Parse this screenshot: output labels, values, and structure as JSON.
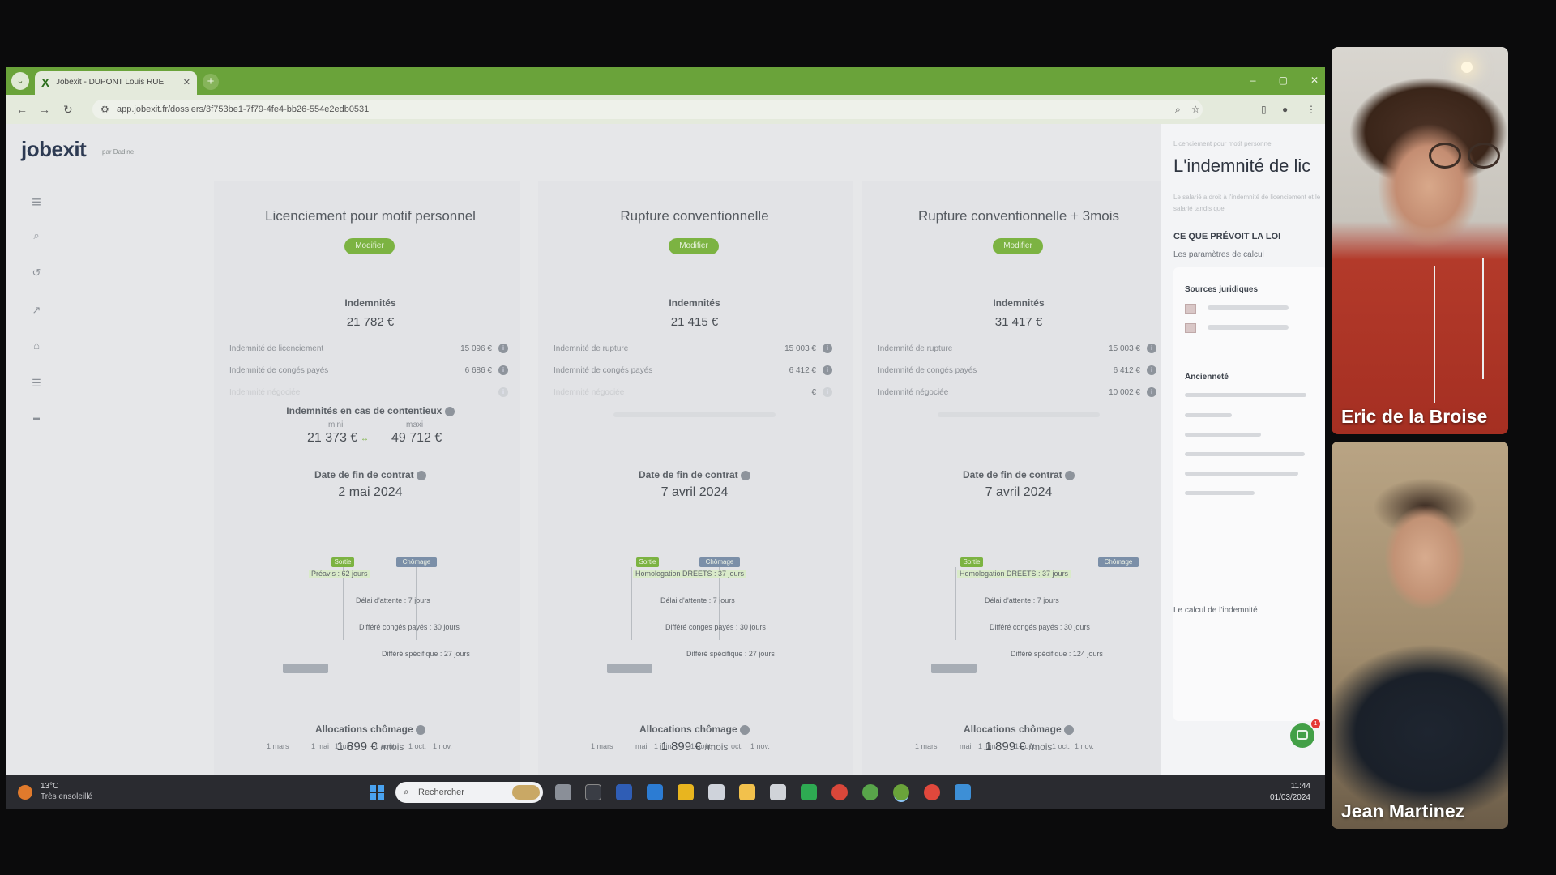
{
  "browser": {
    "tab_title": "Jobexit - DUPONT Louis RUE",
    "url": "app.jobexit.fr/dossiers/3f753be1-7f79-4fe4-bb26-554e2edb0531",
    "win_min": "–",
    "win_max": "▢",
    "win_close": "✕"
  },
  "app": {
    "logo": "jobexit",
    "logo_sub": "par Dadine",
    "columns": [
      {
        "title": "Licenciement pour motif personnel",
        "modifier": "Modifier",
        "indemnites_label": "Indemnités",
        "indemnites_total": "21 782 €",
        "lines": [
          {
            "label": "Indemnité de licenciement",
            "amount": "15 096 €"
          },
          {
            "label": "Indemnité de congés payés",
            "amount": "6 686 €"
          },
          {
            "label": "Indemnité négociée",
            "amount": ""
          }
        ],
        "contentieux_label": "Indemnités en cas de contentieux",
        "min_label": "mini",
        "max_label": "maxi",
        "min_value": "21 373 €",
        "max_value": "49 712 €",
        "date_label": "Date de fin de contrat",
        "date_value": "2 mai 2024",
        "timeline": [
          "Préavis : 62 jours",
          "Délai d'attente : 7 jours",
          "Différé congés payés : 30 jours",
          "Différé spécifique : 27 jours"
        ],
        "chips": [
          "Sortie",
          "Chômage"
        ],
        "axis": [
          "1 mars",
          "1 mai",
          "1 juin",
          "1 août",
          "1 oct.",
          "1 nov."
        ],
        "alloc_label": "Allocations chômage",
        "alloc_value": "1 899 €",
        "alloc_unit": "/mois"
      },
      {
        "title": "Rupture conventionnelle",
        "modifier": "Modifier",
        "indemnites_label": "Indemnités",
        "indemnites_total": "21 415 €",
        "lines": [
          {
            "label": "Indemnité de rupture",
            "amount": "15 003 €"
          },
          {
            "label": "Indemnité de congés payés",
            "amount": "6 412 €"
          },
          {
            "label": "Indemnité négociée",
            "amount": "€"
          }
        ],
        "date_label": "Date de fin de contrat",
        "date_value": "7 avril 2024",
        "timeline": [
          "Homologation DREETS : 37 jours",
          "Délai d'attente : 7 jours",
          "Différé congés payés : 30 jours",
          "Différé spécifique : 27 jours"
        ],
        "chips": [
          "Sortie",
          "Chômage"
        ],
        "axis": [
          "1 mars",
          "mai",
          "1 juin",
          "1 août",
          "oct.",
          "1 nov."
        ],
        "alloc_label": "Allocations chômage",
        "alloc_value": "1 899 €",
        "alloc_unit": "/mois"
      },
      {
        "title": "Rupture conventionnelle + 3mois",
        "modifier": "Modifier",
        "indemnites_label": "Indemnités",
        "indemnites_total": "31 417 €",
        "lines": [
          {
            "label": "Indemnité de rupture",
            "amount": "15 003 €"
          },
          {
            "label": "Indemnité de congés payés",
            "amount": "6 412 €"
          },
          {
            "label": "Indemnité négociée",
            "amount": "10 002 €"
          }
        ],
        "date_label": "Date de fin de contrat",
        "date_value": "7 avril 2024",
        "timeline": [
          "Homologation DREETS : 37 jours",
          "Délai d'attente : 7 jours",
          "Différé congés payés : 30 jours",
          "Différé spécifique : 124 jours"
        ],
        "chips": [
          "Sortie",
          "Chômage"
        ],
        "axis": [
          "1 mars",
          "mai",
          "1 juin",
          "1 août",
          "1 oct.",
          "1 nov."
        ],
        "alloc_label": "Allocations chômage",
        "alloc_value": "1 899 €",
        "alloc_unit": "/mois"
      }
    ]
  },
  "panel": {
    "crumb": "Licenciement pour motif personnel",
    "title": "L'indemnité de lic",
    "blurb": "Le salarié a droit à l'indemnité de licenciement et le salarié tandis que",
    "loi_label": "CE QUE PRÉVOIT LA LOI",
    "params_label": "Les paramètres de calcul",
    "sources_label": "Sources juridiques",
    "anciennete_label": "Ancienneté",
    "calc_label": "Le calcul de l'indemnité"
  },
  "taskbar": {
    "weather_temp": "13°C",
    "weather_desc": "Très ensoleillé",
    "search_placeholder": "Rechercher",
    "time": "11:44",
    "date": "01/03/2024"
  },
  "participants": [
    {
      "name": "Eric de la Broise"
    },
    {
      "name": "Jean Martinez"
    }
  ],
  "colors": {
    "browser_green": "#6aa33a",
    "accent_green": "#7cb342",
    "info_icon": "#8e949c",
    "chip_blue": "#7b8fa8",
    "chat_green": "#43a047"
  }
}
